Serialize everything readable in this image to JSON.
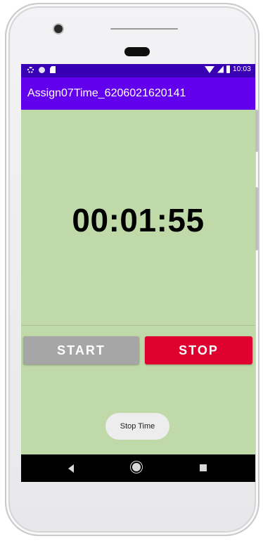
{
  "status_bar": {
    "time": "10:03",
    "left_icons": [
      "gear-icon",
      "circle-icon",
      "sdcard-icon"
    ],
    "right_icons": [
      "wifi-icon",
      "signal-icon",
      "battery-icon"
    ],
    "color": "#3700b3"
  },
  "app_bar": {
    "title": "Assign07Time_6206021620141",
    "color": "#6200ee"
  },
  "timer": {
    "display": "00:01:55",
    "background": "#c0d9a8"
  },
  "buttons": {
    "start_label": "START",
    "stop_label": "STOP",
    "start_color": "#a6a6a6",
    "stop_color": "#e0002f"
  },
  "toast": {
    "message": "Stop Time"
  },
  "nav_bar": {
    "icons": [
      "back-icon",
      "home-icon",
      "recents-icon"
    ]
  }
}
